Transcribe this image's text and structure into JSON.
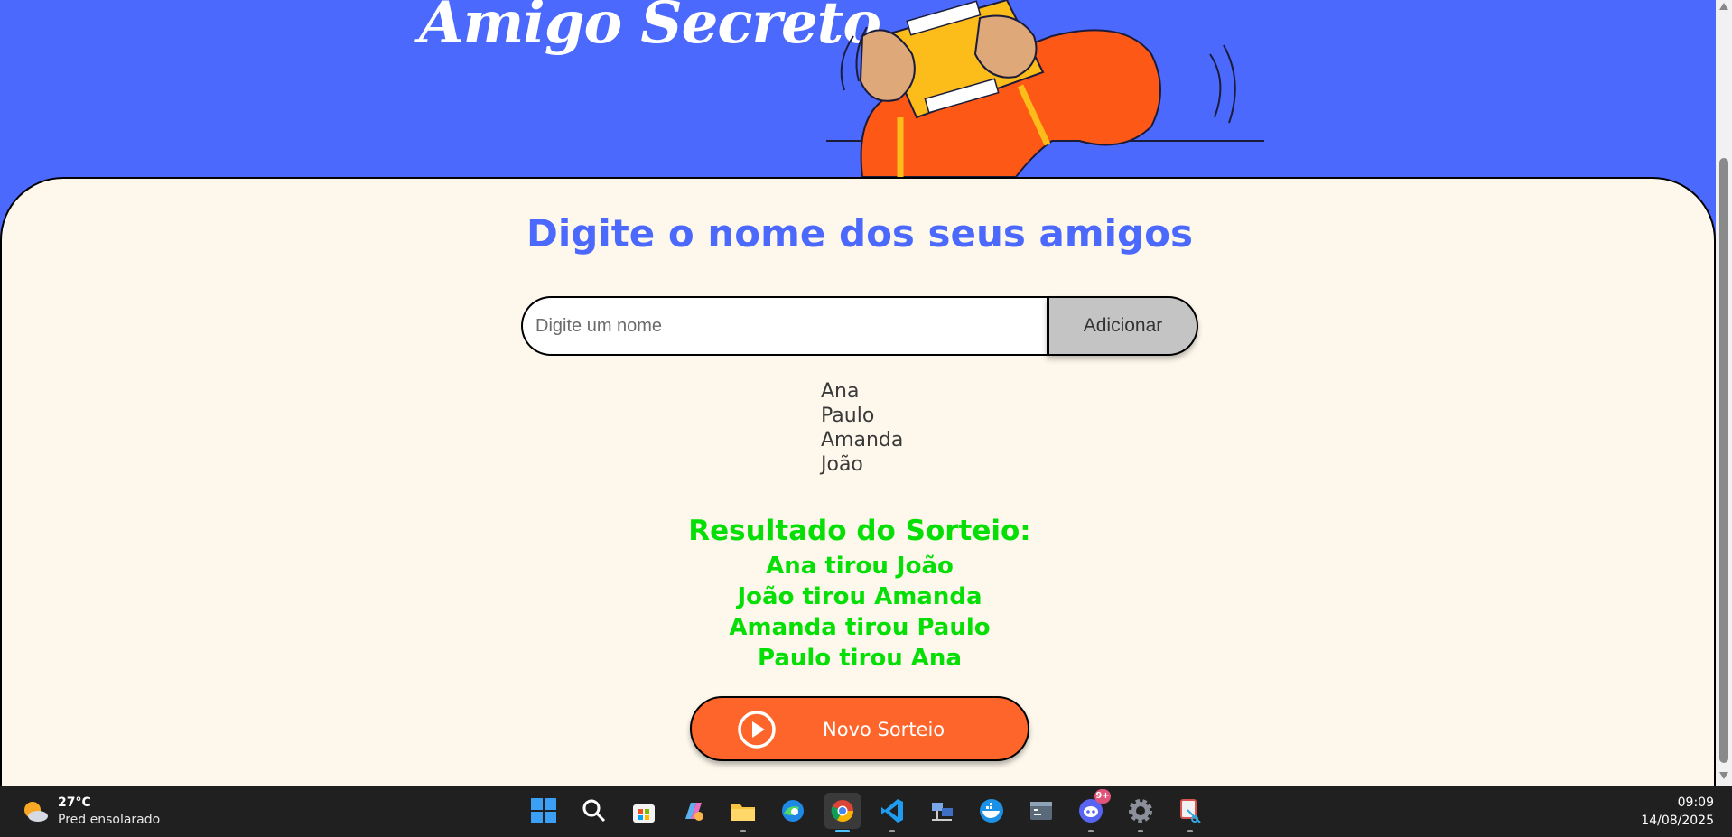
{
  "header": {
    "title": "Amigo Secreto"
  },
  "main": {
    "heading": "Digite o nome dos seus amigos",
    "input_placeholder": "Digite um nome",
    "input_value": "",
    "add_label": "Adicionar",
    "friends": [
      "Ana",
      "Paulo",
      "Amanda",
      "João"
    ],
    "result_title": "Resultado do Sorteio:",
    "results": [
      "Ana tirou João",
      "João tirou Amanda",
      "Amanda tirou Paulo",
      "Paulo tirou Ana"
    ],
    "draw_label": "Novo Sorteio"
  },
  "colors": {
    "header_bg": "#4b69fd",
    "card_bg": "#fef8ec",
    "heading": "#4b69fd",
    "result": "#05df05",
    "draw_button": "#fe652b",
    "add_button": "#c4c4c4"
  },
  "taskbar": {
    "weather_temp": "27°C",
    "weather_desc": "Pred ensolarado",
    "apps": [
      "windows-start-icon",
      "search-icon",
      "microsoft-store-icon",
      "copilot-icon",
      "file-explorer-icon",
      "edge-icon",
      "chrome-icon",
      "vscode-icon",
      "network-app-icon",
      "docker-icon",
      "terminal-icon",
      "discord-icon",
      "settings-icon",
      "snipping-tool-icon"
    ],
    "discord_badge": "9+",
    "time": "09:09",
    "date": "14/08/2025"
  }
}
